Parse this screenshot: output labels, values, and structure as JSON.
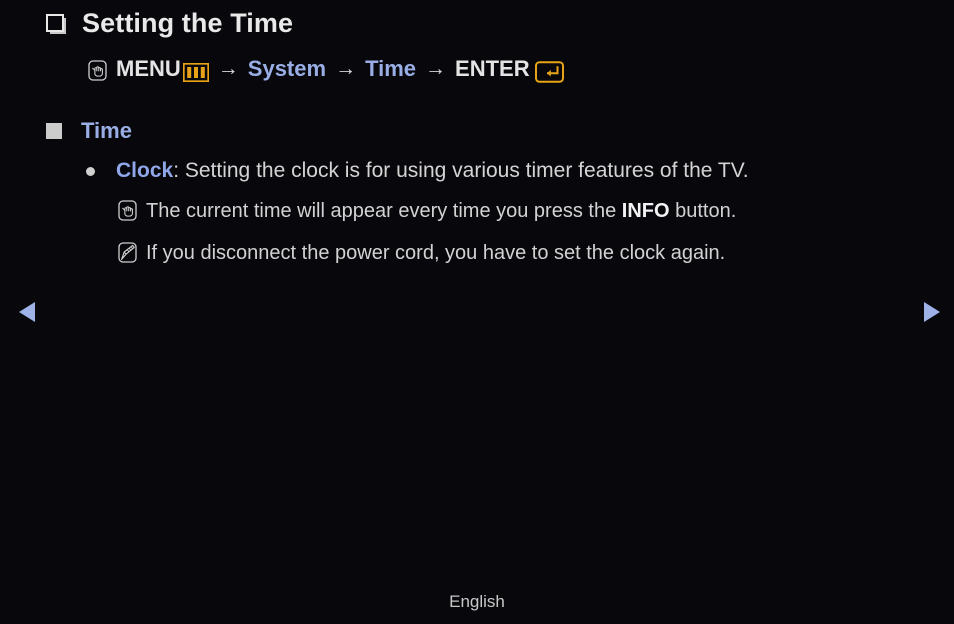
{
  "page": {
    "background_color": "#08080c",
    "accent_blue": "#9aaee6",
    "accent_gold": "#e8a317",
    "text_color": "#d4d4d4"
  },
  "title": {
    "marker_icon": "hollow-square-marker",
    "text": "Setting the Time"
  },
  "menu_path": {
    "lead_icon": "remote-hand-press-icon",
    "segments": [
      {
        "label": "MENU",
        "style": "white",
        "trailing_icon": "menu-bars-gold-icon"
      },
      {
        "label": "System",
        "style": "blue"
      },
      {
        "label": "Time",
        "style": "blue"
      },
      {
        "label": "ENTER",
        "style": "white",
        "trailing_icon": "enter-return-gold-icon"
      }
    ],
    "separator": "→"
  },
  "section": {
    "marker_icon": "filled-square-marker",
    "title": "Time"
  },
  "bullet": {
    "marker_icon": "round-bullet-dot",
    "keyword": "Clock",
    "body": ": Setting the clock is for using various timer features of the TV."
  },
  "notes": [
    {
      "icon": "remote-hand-press-icon",
      "text_before": "The current time will appear every time you press the ",
      "bold": "INFO",
      "text_after": " button."
    },
    {
      "icon": "pencil-note-icon",
      "text_before": "If you disconnect the power cord, you have to set the clock again.",
      "bold": "",
      "text_after": ""
    }
  ],
  "navigation": {
    "previous_label": "◀",
    "next_label": "▶",
    "arrow_color": "#9fb2e8"
  },
  "footer": {
    "language": "English"
  }
}
